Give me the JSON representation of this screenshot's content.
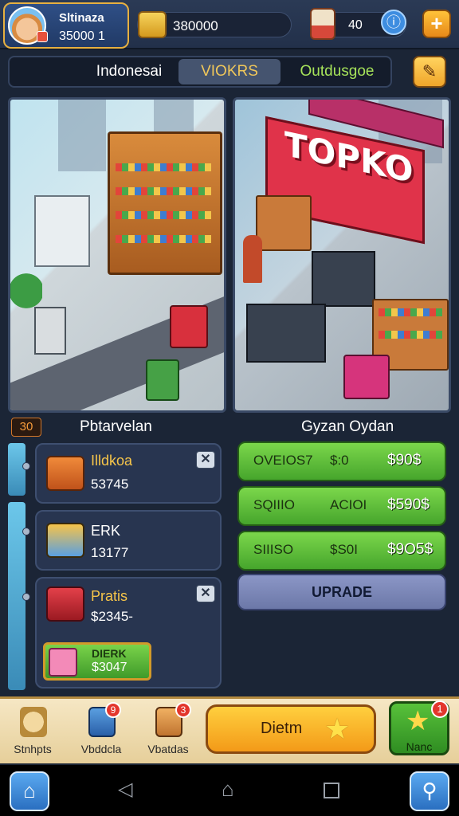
{
  "profile": {
    "name": "Sltinaza",
    "stat": "35000  1"
  },
  "currency": {
    "coins": "380000",
    "gifts": "40"
  },
  "icons": {
    "avatar": "player-avatar",
    "coin": "coin-chest-icon",
    "gift": "gift-box-icon",
    "info": "info-icon",
    "plus": "plus-icon",
    "edit": "edit-pencil-icon",
    "star": "star-icon",
    "home": "home-icon",
    "search": "search-icon"
  },
  "tabs": [
    {
      "label": "Indonesai"
    },
    {
      "label": "VIOKRS"
    },
    {
      "label": "Outdusgoe"
    }
  ],
  "right_scene": {
    "sign": "TOPKO"
  },
  "left_section": {
    "level": "30",
    "title": "Pbtarvelan"
  },
  "right_section": {
    "title": "Gyzan Oydan"
  },
  "items": [
    {
      "name": "Illdkoa",
      "value": "53745"
    },
    {
      "name": "ERK",
      "value": "13177"
    },
    {
      "name": "Pratis",
      "value": "$2345-",
      "sub_title": "DIERK",
      "sub_price": "$3047"
    }
  ],
  "upgrades": [
    {
      "name": "OVEIOS7",
      "mid": "$:0",
      "price": "$90$"
    },
    {
      "name": "SQIIIO",
      "mid": "ACIOI",
      "price": "$590$"
    },
    {
      "name": "SIIISO",
      "mid": "$S0I",
      "price": "$9O5$"
    }
  ],
  "upgrade_button": "UPRADE",
  "bottom_nav": [
    {
      "label": "Stnhpts",
      "badge": ""
    },
    {
      "label": "Vbddcla",
      "badge": "9"
    },
    {
      "label": "Vbatdas",
      "badge": "3"
    }
  ],
  "main_cta": "Dietm",
  "nano": {
    "label": "Nanc",
    "badge": "1"
  },
  "colors": {
    "accent_gold": "#f6c54a",
    "upgrade_green": "#46a52c",
    "cta_orange": "#f39a18",
    "panel_navy": "#283550"
  }
}
